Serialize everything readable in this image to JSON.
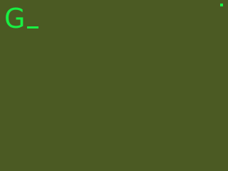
{
  "brand": {
    "glyph": "G"
  },
  "topnav": {
    "text": "",
    "accent": "#19ef43"
  },
  "blocks": [
    {
      "heading": "",
      "text": ""
    },
    {
      "heading": "",
      "text": ""
    },
    {
      "heading": "",
      "text": ""
    },
    {
      "heading": "",
      "text": ""
    }
  ],
  "colors": {
    "background": "#4b5a23",
    "text": "#22dc49",
    "accent": "#19ef43"
  }
}
